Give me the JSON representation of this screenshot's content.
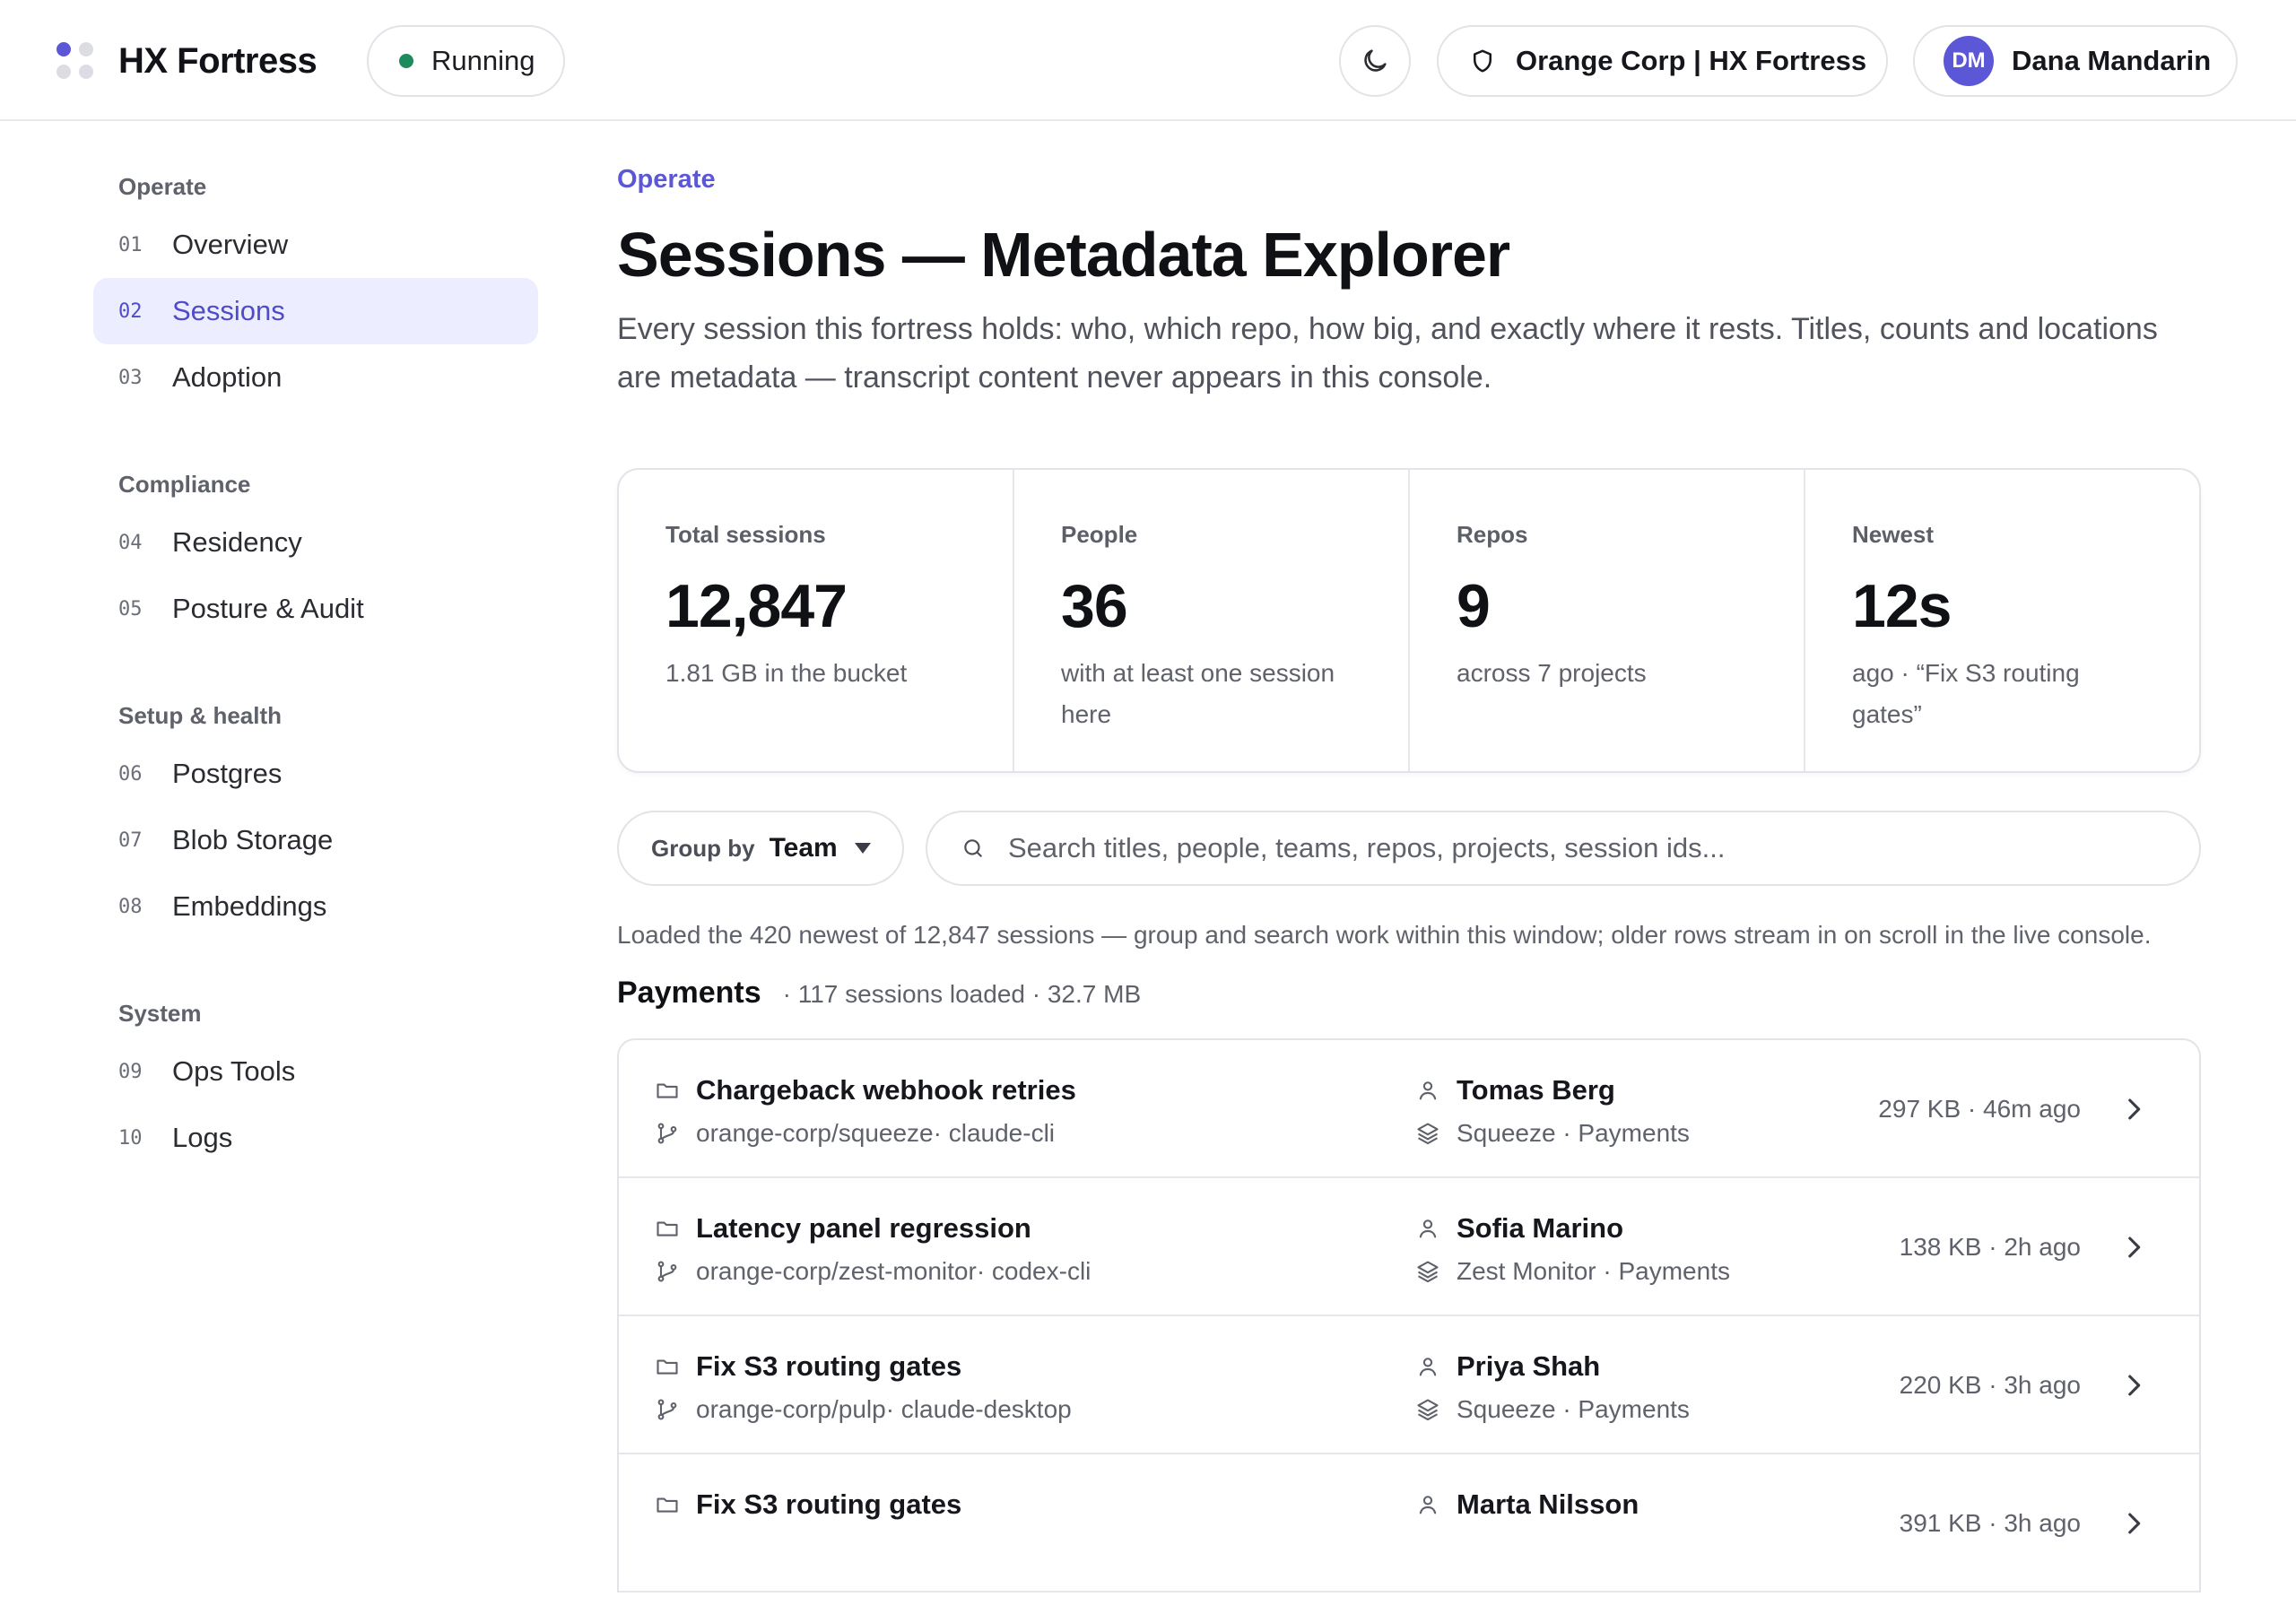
{
  "app": {
    "brand": "HX Fortress",
    "status": "Running",
    "org": "Orange Corp | HX Fortress",
    "user_initials": "DM",
    "user_name": "Dana Mandarin"
  },
  "colors": {
    "accent": "#5b57d6",
    "status_ok": "#1f8a5b",
    "active_bg": "#eceeff"
  },
  "icons": {
    "theme": "moon-icon",
    "org": "shield-icon",
    "search": "search-icon",
    "title": "folder-icon",
    "repo": "git-branch-icon",
    "person": "user-icon",
    "project": "layers-icon",
    "open": "chevron-right-icon"
  },
  "sidebar": {
    "groups": [
      {
        "title": "Operate",
        "items": [
          {
            "num": "01",
            "label": "Overview"
          },
          {
            "num": "02",
            "label": "Sessions",
            "active": true
          },
          {
            "num": "03",
            "label": "Adoption"
          }
        ]
      },
      {
        "title": "Compliance",
        "items": [
          {
            "num": "04",
            "label": "Residency"
          },
          {
            "num": "05",
            "label": "Posture & Audit"
          }
        ]
      },
      {
        "title": "Setup & health",
        "items": [
          {
            "num": "06",
            "label": "Postgres"
          },
          {
            "num": "07",
            "label": "Blob Storage"
          },
          {
            "num": "08",
            "label": "Embeddings"
          }
        ]
      },
      {
        "title": "System",
        "items": [
          {
            "num": "09",
            "label": "Ops Tools"
          },
          {
            "num": "10",
            "label": "Logs"
          }
        ]
      }
    ]
  },
  "main": {
    "eyebrow": "Operate",
    "title": "Sessions — Metadata Explorer",
    "description": "Every session this fortress holds: who, which repo, how big, and exactly where it rests. Titles, counts and locations are metadata — transcript content never appears in this console.",
    "stats": [
      {
        "label": "Total sessions",
        "value": "12,847",
        "sub": "1.81 GB in the bucket"
      },
      {
        "label": "People",
        "value": "36",
        "sub": "with at least one session here"
      },
      {
        "label": "Repos",
        "value": "9",
        "sub": "across 7 projects"
      },
      {
        "label": "Newest",
        "value": "12s",
        "sub": "ago · “Fix S3 routing gates”"
      }
    ],
    "group_by_label": "Group by",
    "group_by_value": "Team",
    "search_placeholder": "Search titles, people, teams, repos, projects, session ids...",
    "loaded_note": "Loaded the 420 newest of 12,847 sessions — group and search work within this window; older rows stream in on scroll in the live console.",
    "group": {
      "name": "Payments",
      "meta": "· 117 sessions loaded · 32.7 MB",
      "rows": [
        {
          "title": "Chargeback webhook retries",
          "repo": "orange-corp/squeeze",
          "client": "· claude-cli",
          "person": "Tomas Berg",
          "project": "Squeeze · Payments",
          "size": "297 KB · 46m ago"
        },
        {
          "title": "Latency panel regression",
          "repo": "orange-corp/zest-monitor",
          "client": "· codex-cli",
          "person": "Sofia Marino",
          "project": "Zest Monitor · Payments",
          "size": "138 KB · 2h ago"
        },
        {
          "title": "Fix S3 routing gates",
          "repo": "orange-corp/pulp",
          "client": "· claude-desktop",
          "person": "Priya Shah",
          "project": "Squeeze · Payments",
          "size": "220 KB · 3h ago"
        },
        {
          "title": "Fix S3 routing gates",
          "repo": "",
          "client": "",
          "person": "Marta Nilsson",
          "project": "",
          "size": "391 KB · 3h ago"
        }
      ]
    }
  }
}
